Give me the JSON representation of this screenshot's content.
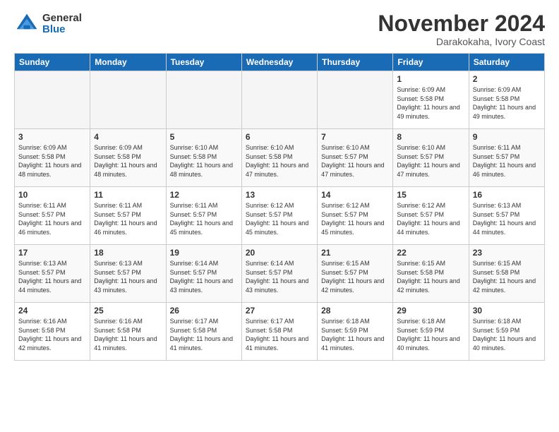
{
  "header": {
    "logo_general": "General",
    "logo_blue": "Blue",
    "month_title": "November 2024",
    "location": "Darakokaha, Ivory Coast"
  },
  "days_of_week": [
    "Sunday",
    "Monday",
    "Tuesday",
    "Wednesday",
    "Thursday",
    "Friday",
    "Saturday"
  ],
  "weeks": [
    [
      {
        "day": "",
        "empty": true
      },
      {
        "day": "",
        "empty": true
      },
      {
        "day": "",
        "empty": true
      },
      {
        "day": "",
        "empty": true
      },
      {
        "day": "",
        "empty": true
      },
      {
        "day": "1",
        "sunrise": "Sunrise: 6:09 AM",
        "sunset": "Sunset: 5:58 PM",
        "daylight": "Daylight: 11 hours and 49 minutes."
      },
      {
        "day": "2",
        "sunrise": "Sunrise: 6:09 AM",
        "sunset": "Sunset: 5:58 PM",
        "daylight": "Daylight: 11 hours and 49 minutes."
      }
    ],
    [
      {
        "day": "3",
        "sunrise": "Sunrise: 6:09 AM",
        "sunset": "Sunset: 5:58 PM",
        "daylight": "Daylight: 11 hours and 48 minutes."
      },
      {
        "day": "4",
        "sunrise": "Sunrise: 6:09 AM",
        "sunset": "Sunset: 5:58 PM",
        "daylight": "Daylight: 11 hours and 48 minutes."
      },
      {
        "day": "5",
        "sunrise": "Sunrise: 6:10 AM",
        "sunset": "Sunset: 5:58 PM",
        "daylight": "Daylight: 11 hours and 48 minutes."
      },
      {
        "day": "6",
        "sunrise": "Sunrise: 6:10 AM",
        "sunset": "Sunset: 5:58 PM",
        "daylight": "Daylight: 11 hours and 47 minutes."
      },
      {
        "day": "7",
        "sunrise": "Sunrise: 6:10 AM",
        "sunset": "Sunset: 5:57 PM",
        "daylight": "Daylight: 11 hours and 47 minutes."
      },
      {
        "day": "8",
        "sunrise": "Sunrise: 6:10 AM",
        "sunset": "Sunset: 5:57 PM",
        "daylight": "Daylight: 11 hours and 47 minutes."
      },
      {
        "day": "9",
        "sunrise": "Sunrise: 6:11 AM",
        "sunset": "Sunset: 5:57 PM",
        "daylight": "Daylight: 11 hours and 46 minutes."
      }
    ],
    [
      {
        "day": "10",
        "sunrise": "Sunrise: 6:11 AM",
        "sunset": "Sunset: 5:57 PM",
        "daylight": "Daylight: 11 hours and 46 minutes."
      },
      {
        "day": "11",
        "sunrise": "Sunrise: 6:11 AM",
        "sunset": "Sunset: 5:57 PM",
        "daylight": "Daylight: 11 hours and 46 minutes."
      },
      {
        "day": "12",
        "sunrise": "Sunrise: 6:11 AM",
        "sunset": "Sunset: 5:57 PM",
        "daylight": "Daylight: 11 hours and 45 minutes."
      },
      {
        "day": "13",
        "sunrise": "Sunrise: 6:12 AM",
        "sunset": "Sunset: 5:57 PM",
        "daylight": "Daylight: 11 hours and 45 minutes."
      },
      {
        "day": "14",
        "sunrise": "Sunrise: 6:12 AM",
        "sunset": "Sunset: 5:57 PM",
        "daylight": "Daylight: 11 hours and 45 minutes."
      },
      {
        "day": "15",
        "sunrise": "Sunrise: 6:12 AM",
        "sunset": "Sunset: 5:57 PM",
        "daylight": "Daylight: 11 hours and 44 minutes."
      },
      {
        "day": "16",
        "sunrise": "Sunrise: 6:13 AM",
        "sunset": "Sunset: 5:57 PM",
        "daylight": "Daylight: 11 hours and 44 minutes."
      }
    ],
    [
      {
        "day": "17",
        "sunrise": "Sunrise: 6:13 AM",
        "sunset": "Sunset: 5:57 PM",
        "daylight": "Daylight: 11 hours and 44 minutes."
      },
      {
        "day": "18",
        "sunrise": "Sunrise: 6:13 AM",
        "sunset": "Sunset: 5:57 PM",
        "daylight": "Daylight: 11 hours and 43 minutes."
      },
      {
        "day": "19",
        "sunrise": "Sunrise: 6:14 AM",
        "sunset": "Sunset: 5:57 PM",
        "daylight": "Daylight: 11 hours and 43 minutes."
      },
      {
        "day": "20",
        "sunrise": "Sunrise: 6:14 AM",
        "sunset": "Sunset: 5:57 PM",
        "daylight": "Daylight: 11 hours and 43 minutes."
      },
      {
        "day": "21",
        "sunrise": "Sunrise: 6:15 AM",
        "sunset": "Sunset: 5:57 PM",
        "daylight": "Daylight: 11 hours and 42 minutes."
      },
      {
        "day": "22",
        "sunrise": "Sunrise: 6:15 AM",
        "sunset": "Sunset: 5:58 PM",
        "daylight": "Daylight: 11 hours and 42 minutes."
      },
      {
        "day": "23",
        "sunrise": "Sunrise: 6:15 AM",
        "sunset": "Sunset: 5:58 PM",
        "daylight": "Daylight: 11 hours and 42 minutes."
      }
    ],
    [
      {
        "day": "24",
        "sunrise": "Sunrise: 6:16 AM",
        "sunset": "Sunset: 5:58 PM",
        "daylight": "Daylight: 11 hours and 42 minutes."
      },
      {
        "day": "25",
        "sunrise": "Sunrise: 6:16 AM",
        "sunset": "Sunset: 5:58 PM",
        "daylight": "Daylight: 11 hours and 41 minutes."
      },
      {
        "day": "26",
        "sunrise": "Sunrise: 6:17 AM",
        "sunset": "Sunset: 5:58 PM",
        "daylight": "Daylight: 11 hours and 41 minutes."
      },
      {
        "day": "27",
        "sunrise": "Sunrise: 6:17 AM",
        "sunset": "Sunset: 5:58 PM",
        "daylight": "Daylight: 11 hours and 41 minutes."
      },
      {
        "day": "28",
        "sunrise": "Sunrise: 6:18 AM",
        "sunset": "Sunset: 5:59 PM",
        "daylight": "Daylight: 11 hours and 41 minutes."
      },
      {
        "day": "29",
        "sunrise": "Sunrise: 6:18 AM",
        "sunset": "Sunset: 5:59 PM",
        "daylight": "Daylight: 11 hours and 40 minutes."
      },
      {
        "day": "30",
        "sunrise": "Sunrise: 6:18 AM",
        "sunset": "Sunset: 5:59 PM",
        "daylight": "Daylight: 11 hours and 40 minutes."
      }
    ]
  ]
}
